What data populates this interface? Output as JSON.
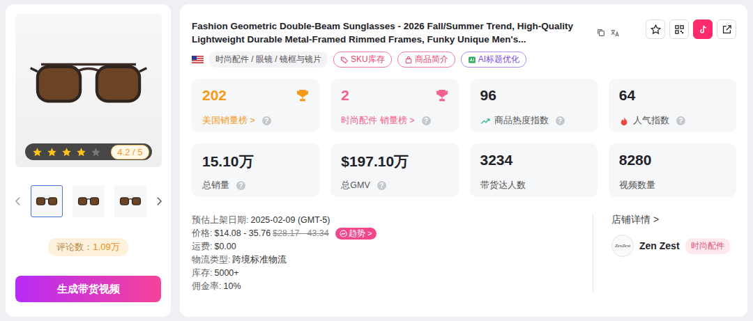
{
  "gallery": {
    "rating": {
      "stars": 4,
      "star_count": 5,
      "text": "4.2 / 5"
    },
    "thumbnails": [
      {
        "selected": true
      },
      {
        "selected": false
      },
      {
        "selected": false
      }
    ],
    "reviews": {
      "label": "评论数：",
      "value": "1.09万"
    },
    "generate_button": "生成带货视频"
  },
  "title": "Fashion Geometric Double-Beam Sunglasses - 2026 Fall/Summer Trend, High-Quality Lightweight Durable Metal-Framed Rimmed Frames, Funky Unique Men's...",
  "category": "时尚配件 / 眼镜 / 镜框与镜片",
  "tags": [
    {
      "label": "SKU库存",
      "kind": "sku"
    },
    {
      "label": "商品简介",
      "kind": "intro"
    },
    {
      "label": "AI标题优化",
      "kind": "ai"
    }
  ],
  "stats": [
    {
      "value": "202",
      "label": "美国销量榜 >",
      "help": "?",
      "kind": "rank",
      "color": "#f59a1b"
    },
    {
      "value": "2",
      "label": "时尚配件 销量榜 >",
      "help": "?",
      "kind": "rank",
      "color": "#f2628a"
    },
    {
      "value": "96",
      "label": "商品热度指数",
      "help": "?",
      "kind": "heat",
      "color": "#1f2329"
    },
    {
      "value": "64",
      "label": "人气指数",
      "help": "?",
      "kind": "popularity",
      "color": "#1f2329"
    },
    {
      "value": "15.10万",
      "label": "总销量",
      "help": "?",
      "kind": "plain",
      "color": "#1f2329"
    },
    {
      "value": "$197.10万",
      "label": "总GMV",
      "help": "?",
      "kind": "plain",
      "color": "#1f2329"
    },
    {
      "value": "3234",
      "label": "带货达人数",
      "help": "",
      "kind": "plain",
      "color": "#1f2329"
    },
    {
      "value": "8280",
      "label": "视频数量",
      "help": "",
      "kind": "plain",
      "color": "#1f2329"
    }
  ],
  "details": [
    {
      "label": "预估上架日期:",
      "value": "2025-02-09 (GMT-5)",
      "kind": "text"
    },
    {
      "label": "价格:",
      "value": "$14.08 - 35.76",
      "original": "$28.17 - 43.34",
      "badge": "趋势 >",
      "kind": "price"
    },
    {
      "label": "运费:",
      "value": "$0.00",
      "kind": "text"
    },
    {
      "label": "物流类型:",
      "value": "跨境标准物流",
      "kind": "text"
    },
    {
      "label": "库存:",
      "value": "5000+",
      "kind": "text"
    },
    {
      "label": "佣金率:",
      "value": "10%",
      "kind": "text"
    }
  ],
  "shop": {
    "heading": "店铺详情 >",
    "avatar_text": "ZenZest",
    "name": "Zen Zest",
    "tag": "时尚配件"
  }
}
